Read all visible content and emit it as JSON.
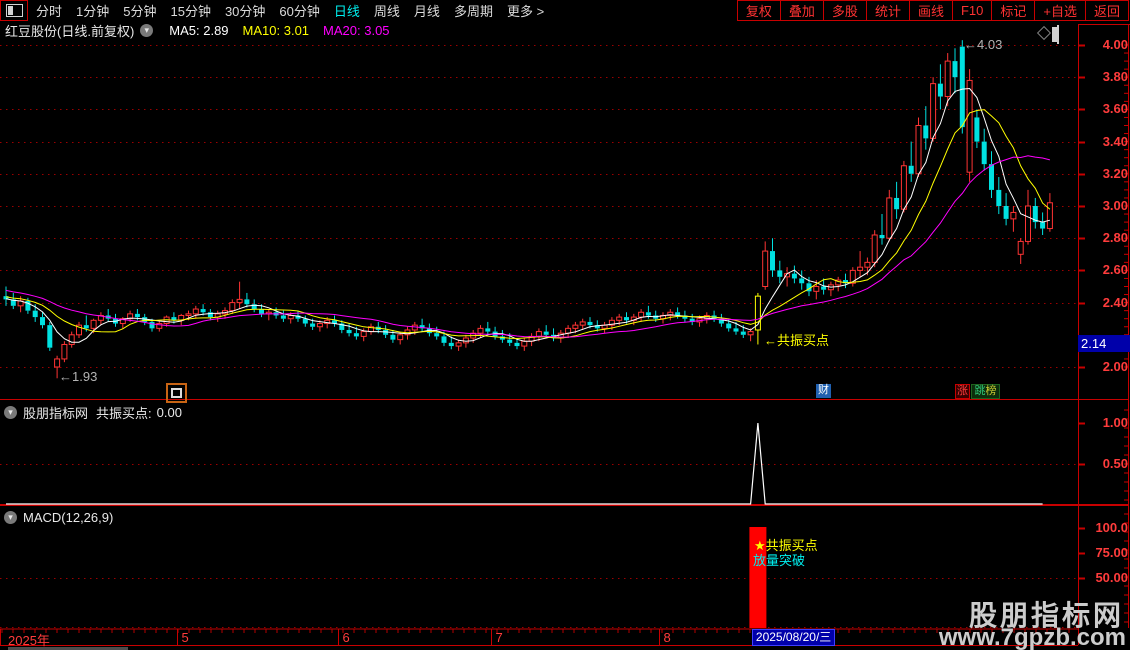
{
  "toolbar": {
    "items": [
      {
        "label": "分时",
        "active": false
      },
      {
        "label": "1分钟",
        "active": false
      },
      {
        "label": "5分钟",
        "active": false
      },
      {
        "label": "15分钟",
        "active": false
      },
      {
        "label": "30分钟",
        "active": false
      },
      {
        "label": "60分钟",
        "active": false
      },
      {
        "label": "日线",
        "active": true
      },
      {
        "label": "周线",
        "active": false
      },
      {
        "label": "月线",
        "active": false
      },
      {
        "label": "多周期",
        "active": false
      },
      {
        "label": "更多 >",
        "active": false
      }
    ],
    "right_items": [
      "复权",
      "叠加",
      "多股",
      "统计",
      "画线",
      "F10",
      "标记",
      "+自选",
      "返回"
    ]
  },
  "title_bar": {
    "title": "红豆股份(日线.前复权)",
    "ma5": "MA5: 2.89",
    "ma10": "MA10: 3.01",
    "ma20": "MA20: 3.05"
  },
  "main_chart": {
    "y_labels": [
      4.0,
      3.8,
      3.6,
      3.4,
      3.2,
      3.0,
      2.8,
      2.6,
      2.4,
      2.0
    ],
    "price_marker": "2.14",
    "peak_annotation": "←4.03",
    "low_annotation": "←1.93",
    "signal_annotation": "←共振买点",
    "badge_cai": "财",
    "badge_zhang": "涨",
    "badge_bang_1": "跳",
    "badge_bang_2": "榜"
  },
  "panel2": {
    "source": "股朋指标网",
    "label": "共振买点:",
    "value": "0.00",
    "y_labels": [
      1.0,
      0.5
    ]
  },
  "macd": {
    "label": "MACD(12,26,9)",
    "y_labels": [
      "100.0",
      "75.00",
      "50.00"
    ],
    "signal_line1": "★共振买点",
    "signal_line2": "放量突破"
  },
  "x_axis": {
    "year_label": "2025年",
    "highlight_date": "2025/08/20/三"
  },
  "watermark": {
    "line1": "股朋指标网",
    "line2": "www.7gpzb.com"
  },
  "colors": {
    "up": "#ff3434",
    "down": "#00e1e1",
    "signal_candle": "#ffff00",
    "ma5": "#ffffff",
    "ma10": "#ffff00",
    "ma20": "#ff00ff",
    "grid": "#9c0000",
    "axis": "#c80000",
    "axis_text": "#ff3c3c",
    "macd_bar": "#ff0000",
    "indicator_line": "#ffffff",
    "marker_bg": "#0000aa",
    "active_tab": "#00f0f0"
  },
  "chart_data": {
    "type": "candlestick",
    "title": "红豆股份 daily candles with MA5/MA10/MA20",
    "ylim": [
      1.93,
      4.03
    ],
    "signal_index": 103,
    "panel2_series": {
      "baseline": 0.0,
      "spike_index": 103,
      "spike_value": 1.0,
      "ylim": [
        0,
        1.25
      ]
    },
    "macd_panel": {
      "signal_bar_index": 103,
      "signal_bar_value": 101,
      "ylim": [
        0,
        118
      ],
      "gridlines": [
        50,
        0
      ]
    },
    "month_ticks": [
      {
        "index": 24,
        "label": "5"
      },
      {
        "index": 46,
        "label": "6"
      },
      {
        "index": 67,
        "label": "7"
      },
      {
        "index": 90,
        "label": "8"
      }
    ],
    "ma_periods": [
      5,
      10,
      20
    ],
    "ma_seed": [
      2.56,
      2.55,
      2.54,
      2.53,
      2.52,
      2.51,
      2.5,
      2.49,
      2.48,
      2.47,
      2.46,
      2.45,
      2.45,
      2.44,
      2.44,
      2.43,
      2.43,
      2.42,
      2.42
    ],
    "ohlc": [
      [
        2.44,
        2.5,
        2.38,
        2.42
      ],
      [
        2.42,
        2.46,
        2.36,
        2.38
      ],
      [
        2.38,
        2.44,
        2.34,
        2.41
      ],
      [
        2.41,
        2.43,
        2.33,
        2.35
      ],
      [
        2.35,
        2.39,
        2.28,
        2.31
      ],
      [
        2.31,
        2.34,
        2.24,
        2.26
      ],
      [
        2.26,
        2.28,
        2.1,
        2.12
      ],
      [
        2.0,
        2.07,
        1.93,
        2.05
      ],
      [
        2.05,
        2.16,
        2.03,
        2.14
      ],
      [
        2.14,
        2.22,
        2.12,
        2.2
      ],
      [
        2.2,
        2.28,
        2.18,
        2.26
      ],
      [
        2.26,
        2.32,
        2.22,
        2.24
      ],
      [
        2.24,
        2.3,
        2.21,
        2.29
      ],
      [
        2.29,
        2.34,
        2.26,
        2.32
      ],
      [
        2.32,
        2.36,
        2.28,
        2.3
      ],
      [
        2.3,
        2.33,
        2.25,
        2.27
      ],
      [
        2.27,
        2.31,
        2.24,
        2.3
      ],
      [
        2.3,
        2.35,
        2.28,
        2.33
      ],
      [
        2.33,
        2.36,
        2.29,
        2.31
      ],
      [
        2.31,
        2.33,
        2.26,
        2.28
      ],
      [
        2.28,
        2.3,
        2.22,
        2.24
      ],
      [
        2.24,
        2.29,
        2.22,
        2.27
      ],
      [
        2.27,
        2.32,
        2.25,
        2.31
      ],
      [
        2.31,
        2.34,
        2.27,
        2.29
      ],
      [
        2.29,
        2.33,
        2.26,
        2.32
      ],
      [
        2.32,
        2.35,
        2.29,
        2.33
      ],
      [
        2.33,
        2.38,
        2.3,
        2.36
      ],
      [
        2.36,
        2.39,
        2.32,
        2.34
      ],
      [
        2.34,
        2.36,
        2.29,
        2.31
      ],
      [
        2.31,
        2.35,
        2.28,
        2.33
      ],
      [
        2.33,
        2.37,
        2.3,
        2.35
      ],
      [
        2.35,
        2.42,
        2.33,
        2.4
      ],
      [
        2.4,
        2.53,
        2.36,
        2.42
      ],
      [
        2.42,
        2.46,
        2.37,
        2.39
      ],
      [
        2.39,
        2.42,
        2.34,
        2.36
      ],
      [
        2.36,
        2.39,
        2.31,
        2.33
      ],
      [
        2.33,
        2.36,
        2.29,
        2.34
      ],
      [
        2.34,
        2.37,
        2.3,
        2.32
      ],
      [
        2.32,
        2.35,
        2.28,
        2.3
      ],
      [
        2.3,
        2.34,
        2.27,
        2.32
      ],
      [
        2.32,
        2.35,
        2.28,
        2.3
      ],
      [
        2.3,
        2.32,
        2.25,
        2.27
      ],
      [
        2.27,
        2.3,
        2.23,
        2.25
      ],
      [
        2.25,
        2.29,
        2.22,
        2.27
      ],
      [
        2.27,
        2.31,
        2.24,
        2.29
      ],
      [
        2.29,
        2.32,
        2.25,
        2.27
      ],
      [
        2.27,
        2.29,
        2.21,
        2.23
      ],
      [
        2.23,
        2.27,
        2.19,
        2.21
      ],
      [
        2.21,
        2.25,
        2.17,
        2.19
      ],
      [
        2.19,
        2.24,
        2.16,
        2.22
      ],
      [
        2.22,
        2.27,
        2.2,
        2.25
      ],
      [
        2.25,
        2.28,
        2.21,
        2.23
      ],
      [
        2.23,
        2.26,
        2.18,
        2.2
      ],
      [
        2.2,
        2.23,
        2.15,
        2.17
      ],
      [
        2.17,
        2.22,
        2.14,
        2.2
      ],
      [
        2.2,
        2.25,
        2.17,
        2.23
      ],
      [
        2.23,
        2.28,
        2.2,
        2.26
      ],
      [
        2.26,
        2.3,
        2.22,
        2.24
      ],
      [
        2.24,
        2.27,
        2.19,
        2.21
      ],
      [
        2.21,
        2.25,
        2.17,
        2.19
      ],
      [
        2.19,
        2.22,
        2.13,
        2.15
      ],
      [
        2.15,
        2.19,
        2.11,
        2.13
      ],
      [
        2.13,
        2.17,
        2.1,
        2.15
      ],
      [
        2.15,
        2.2,
        2.12,
        2.18
      ],
      [
        2.18,
        2.23,
        2.15,
        2.21
      ],
      [
        2.21,
        2.26,
        2.18,
        2.24
      ],
      [
        2.24,
        2.28,
        2.2,
        2.22
      ],
      [
        2.22,
        2.25,
        2.17,
        2.19
      ],
      [
        2.19,
        2.23,
        2.15,
        2.17
      ],
      [
        2.17,
        2.21,
        2.13,
        2.15
      ],
      [
        2.15,
        2.18,
        2.11,
        2.13
      ],
      [
        2.13,
        2.18,
        2.1,
        2.16
      ],
      [
        2.16,
        2.21,
        2.13,
        2.19
      ],
      [
        2.19,
        2.24,
        2.16,
        2.22
      ],
      [
        2.22,
        2.26,
        2.18,
        2.2
      ],
      [
        2.2,
        2.24,
        2.16,
        2.18
      ],
      [
        2.18,
        2.23,
        2.15,
        2.21
      ],
      [
        2.21,
        2.26,
        2.18,
        2.24
      ],
      [
        2.24,
        2.28,
        2.21,
        2.26
      ],
      [
        2.26,
        2.3,
        2.23,
        2.28
      ],
      [
        2.28,
        2.31,
        2.24,
        2.26
      ],
      [
        2.26,
        2.29,
        2.22,
        2.24
      ],
      [
        2.24,
        2.28,
        2.21,
        2.26
      ],
      [
        2.26,
        2.31,
        2.23,
        2.29
      ],
      [
        2.29,
        2.33,
        2.26,
        2.31
      ],
      [
        2.31,
        2.34,
        2.27,
        2.29
      ],
      [
        2.29,
        2.33,
        2.26,
        2.31
      ],
      [
        2.31,
        2.36,
        2.28,
        2.34
      ],
      [
        2.34,
        2.38,
        2.3,
        2.32
      ],
      [
        2.32,
        2.35,
        2.28,
        2.3
      ],
      [
        2.3,
        2.34,
        2.27,
        2.32
      ],
      [
        2.32,
        2.36,
        2.29,
        2.34
      ],
      [
        2.34,
        2.37,
        2.3,
        2.32
      ],
      [
        2.32,
        2.35,
        2.28,
        2.3
      ],
      [
        2.3,
        2.33,
        2.26,
        2.28
      ],
      [
        2.28,
        2.32,
        2.25,
        2.3
      ],
      [
        2.3,
        2.34,
        2.27,
        2.32
      ],
      [
        2.32,
        2.35,
        2.28,
        2.3
      ],
      [
        2.3,
        2.33,
        2.25,
        2.27
      ],
      [
        2.27,
        2.3,
        2.22,
        2.24
      ],
      [
        2.24,
        2.28,
        2.2,
        2.22
      ],
      [
        2.22,
        2.26,
        2.18,
        2.2
      ],
      [
        2.2,
        2.24,
        2.16,
        2.22
      ],
      [
        2.23,
        2.46,
        2.14,
        2.44
      ],
      [
        2.5,
        2.78,
        2.48,
        2.72
      ],
      [
        2.72,
        2.8,
        2.56,
        2.6
      ],
      [
        2.6,
        2.66,
        2.52,
        2.56
      ],
      [
        2.56,
        2.62,
        2.5,
        2.58
      ],
      [
        2.58,
        2.63,
        2.52,
        2.55
      ],
      [
        2.55,
        2.6,
        2.48,
        2.52
      ],
      [
        2.52,
        2.56,
        2.44,
        2.47
      ],
      [
        2.47,
        2.54,
        2.42,
        2.5
      ],
      [
        2.5,
        2.55,
        2.45,
        2.48
      ],
      [
        2.48,
        2.53,
        2.44,
        2.51
      ],
      [
        2.51,
        2.56,
        2.47,
        2.54
      ],
      [
        2.54,
        2.58,
        2.49,
        2.52
      ],
      [
        2.52,
        2.62,
        2.5,
        2.6
      ],
      [
        2.6,
        2.72,
        2.56,
        2.62
      ],
      [
        2.62,
        2.68,
        2.57,
        2.65
      ],
      [
        2.65,
        2.85,
        2.62,
        2.82
      ],
      [
        2.82,
        2.95,
        2.76,
        2.8
      ],
      [
        2.8,
        3.1,
        2.78,
        3.05
      ],
      [
        3.05,
        3.15,
        2.92,
        2.98
      ],
      [
        2.98,
        3.28,
        2.96,
        3.25
      ],
      [
        3.25,
        3.4,
        3.15,
        3.2
      ],
      [
        3.2,
        3.55,
        3.18,
        3.5
      ],
      [
        3.5,
        3.62,
        3.35,
        3.42
      ],
      [
        3.42,
        3.8,
        3.4,
        3.76
      ],
      [
        3.76,
        3.88,
        3.6,
        3.68
      ],
      [
        3.68,
        3.95,
        3.62,
        3.9
      ],
      [
        3.9,
        3.98,
        3.7,
        3.8
      ],
      [
        3.99,
        4.03,
        3.45,
        3.49
      ],
      [
        3.21,
        3.85,
        3.15,
        3.78
      ],
      [
        3.55,
        3.6,
        3.36,
        3.4
      ],
      [
        3.4,
        3.48,
        3.22,
        3.26
      ],
      [
        3.26,
        3.34,
        3.05,
        3.1
      ],
      [
        3.1,
        3.18,
        2.95,
        3.0
      ],
      [
        3.0,
        3.08,
        2.88,
        2.92
      ],
      [
        2.92,
        3.0,
        2.84,
        2.96
      ],
      [
        2.7,
        2.8,
        2.64,
        2.78
      ],
      [
        2.78,
        3.1,
        2.76,
        3.0
      ],
      [
        3.0,
        3.05,
        2.86,
        2.9
      ],
      [
        2.9,
        2.96,
        2.82,
        2.86
      ],
      [
        2.86,
        3.08,
        2.84,
        3.02
      ]
    ]
  }
}
